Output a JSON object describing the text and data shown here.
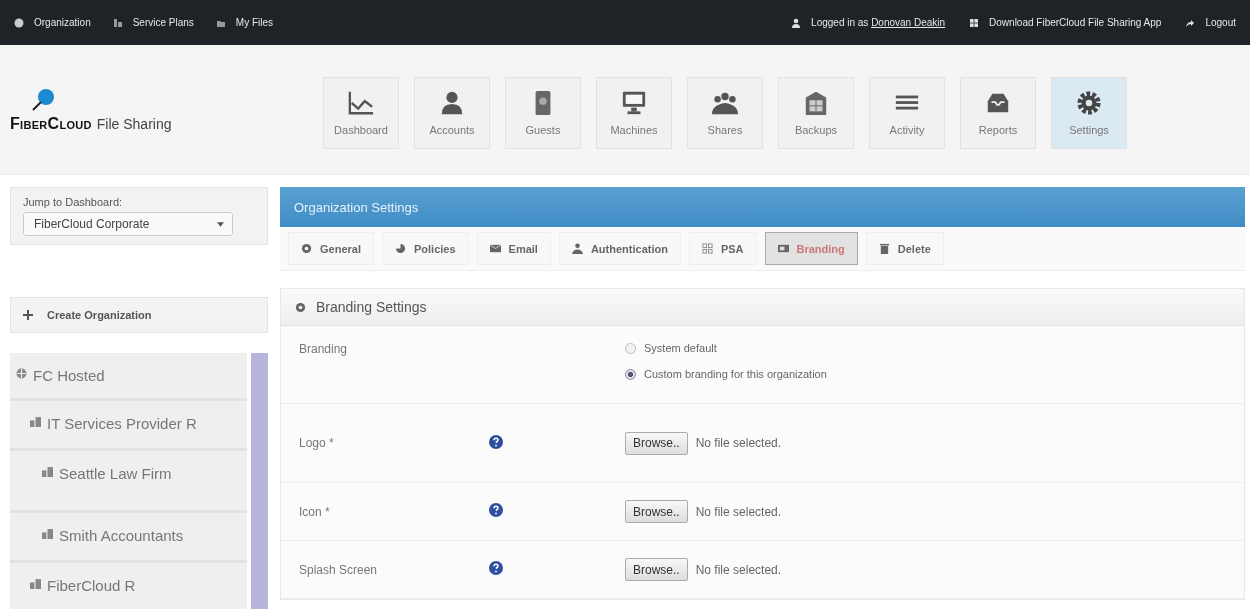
{
  "top_bar": {
    "left_links": [
      {
        "label": "Organization"
      },
      {
        "label": "Service Plans"
      },
      {
        "label": "My Files"
      }
    ],
    "login": {
      "text": "Logged in as",
      "user": "Donovan Deakin"
    },
    "download": "Download FiberCloud File Sharing App",
    "logout": "Logout"
  },
  "logo": {
    "brand": "FiberCloud",
    "product": "File Sharing"
  },
  "nav": [
    {
      "label": "Dashboard",
      "selected": false
    },
    {
      "label": "Accounts",
      "selected": false
    },
    {
      "label": "Guests",
      "selected": false
    },
    {
      "label": "Machines",
      "selected": false
    },
    {
      "label": "Shares",
      "selected": false
    },
    {
      "label": "Backups",
      "selected": false
    },
    {
      "label": "Activity",
      "selected": false
    },
    {
      "label": "Reports",
      "selected": false
    },
    {
      "label": "Settings",
      "selected": true
    }
  ],
  "sidebar": {
    "jump_label": "Jump to Dashboard:",
    "jump_value": "FiberCloud Corporate",
    "create": "Create Organization",
    "tree": [
      {
        "label": "FC Hosted",
        "children": [
          {
            "label": "IT Services Provider R",
            "children": [
              {
                "label": "Seattle Law Firm"
              },
              {
                "label": "Smith Accountants"
              }
            ]
          },
          {
            "label": "FiberCloud R"
          }
        ]
      }
    ]
  },
  "panel": {
    "title": "Organization Settings",
    "tabs": [
      {
        "label": "General",
        "selected": false
      },
      {
        "label": "Policies",
        "selected": false
      },
      {
        "label": "Email",
        "selected": false
      },
      {
        "label": "Authentication",
        "selected": false
      },
      {
        "label": "PSA",
        "selected": false
      },
      {
        "label": "Branding",
        "selected": true
      },
      {
        "label": "Delete",
        "selected": false
      }
    ],
    "section": "Branding Settings",
    "rows": [
      {
        "kind": "radio",
        "label": "Branding",
        "options": [
          {
            "label": "System default",
            "selected": false
          },
          {
            "label": "Custom branding for this organization",
            "selected": true
          }
        ]
      },
      {
        "kind": "file",
        "label": "Logo *",
        "button": "Browse..",
        "status": "No file selected."
      },
      {
        "kind": "file",
        "label": "Icon *",
        "button": "Browse..",
        "status": "No file selected."
      },
      {
        "kind": "file",
        "label": "Splash Screen",
        "button": "Browse..",
        "status": "No file selected."
      }
    ]
  }
}
